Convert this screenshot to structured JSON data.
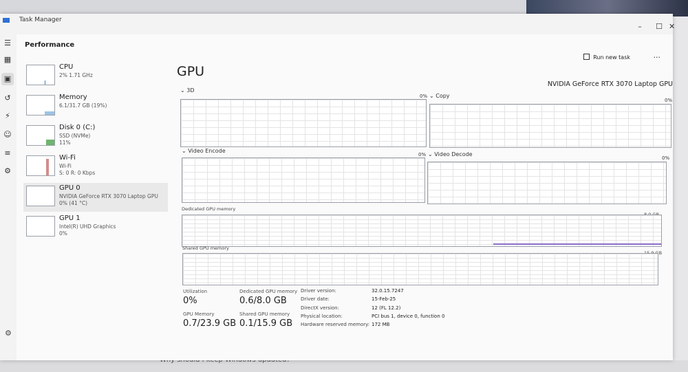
{
  "window": {
    "title": "Task Manager"
  },
  "background": {
    "bottom_text": "Why should I keep Windows updated?"
  },
  "nav": {
    "icons": [
      "menu-icon",
      "processes-icon",
      "performance-icon",
      "app-history-icon",
      "startup-icon",
      "users-icon",
      "details-icon",
      "services-icon"
    ]
  },
  "header": {
    "section": "Performance",
    "run_new_task": "Run new task",
    "more": "..."
  },
  "sidebar": {
    "items": [
      {
        "name": "CPU",
        "sub1": "2% 1.71 GHz",
        "sub2": "",
        "sub3": ""
      },
      {
        "name": "Memory",
        "sub1": "6.1/31.7 GB (19%)",
        "sub2": "",
        "sub3": ""
      },
      {
        "name": "Disk 0 (C:)",
        "sub1": "SSD (NVMe)",
        "sub2": "11%",
        "sub3": ""
      },
      {
        "name": "Wi-Fi",
        "sub1": "Wi-Fi",
        "sub2": "S: 0 R: 0 Kbps",
        "sub3": ""
      },
      {
        "name": "GPU 0",
        "sub1": "NVIDIA GeForce RTX 3070 Laptop GPU",
        "sub2": "0% (41 °C)",
        "sub3": ""
      },
      {
        "name": "GPU 1",
        "sub1": "Intel(R) UHD Graphics",
        "sub2": "0%",
        "sub3": ""
      }
    ]
  },
  "gpu": {
    "title": "GPU",
    "model": "NVIDIA GeForce RTX 3070 Laptop GPU",
    "engines": [
      {
        "label": "3D",
        "pct": "0%"
      },
      {
        "label": "Copy",
        "pct": "0%"
      },
      {
        "label": "Video Encode",
        "pct": "0%"
      },
      {
        "label": "Video Decode",
        "pct": "0%"
      }
    ],
    "dedicated_label": "Dedicated GPU memory",
    "dedicated_cap": "8.0 GB",
    "shared_label": "Shared GPU memory",
    "shared_cap": "15.9 GB"
  },
  "stats": {
    "utilization_label": "Utilization",
    "utilization": "0%",
    "dedicated_label": "Dedicated GPU memory",
    "dedicated": "0.6/8.0 GB",
    "gpu_memory_label": "GPU Memory",
    "gpu_memory": "0.7/23.9 GB",
    "shared_label": "Shared GPU memory",
    "shared": "0.1/15.9 GB"
  },
  "details": [
    {
      "label": "Driver version:",
      "value": "32.0.15.7247"
    },
    {
      "label": "Driver date:",
      "value": "15-Feb-25"
    },
    {
      "label": "DirectX version:",
      "value": "12 (FL 12.2)"
    },
    {
      "label": "Physical location:",
      "value": "PCI bus 1, device 0, function 0"
    },
    {
      "label": "Hardware reserved memory:",
      "value": "172 MB"
    }
  ]
}
